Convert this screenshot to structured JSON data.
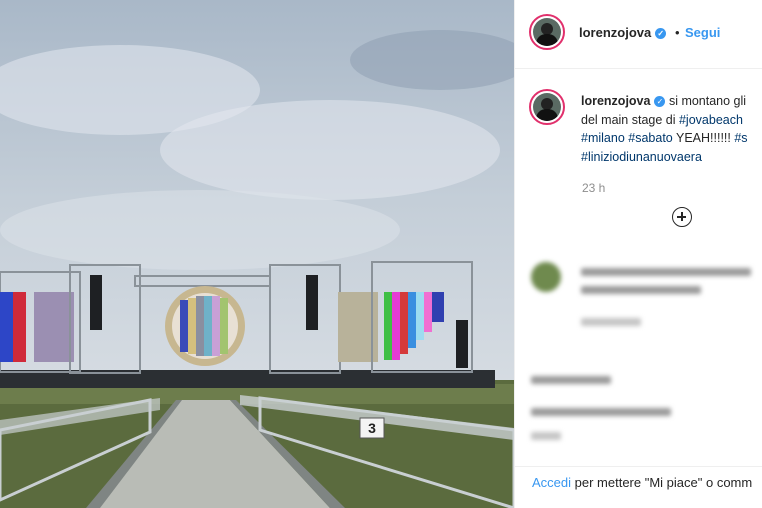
{
  "post": {
    "username": "lorenzojova",
    "verified_icon": "verified-badge-icon",
    "separator": "•",
    "follow_label": "Segui"
  },
  "caption": {
    "username": "lorenzojova",
    "line1_text": " si montano gli",
    "line2_text": "del main stage di ",
    "line2_tag": "#jovabeach",
    "line3_tag1": "#milano",
    "line3_tag2": "#sabato",
    "line3_text": " YEAH!!!!!! ",
    "line3_tag3": "#s",
    "line4_tag": "#liniziodiunanuovaera"
  },
  "time_label": "23 h",
  "load_more_icon": "plus-circle-icon",
  "footer": {
    "login_label": "Accedi",
    "rest_label": " per mettere \"Mi piace\" o comm"
  },
  "photo": {
    "sign_number": "3"
  },
  "colors": {
    "accent": "#3897f0",
    "text": "#262626",
    "muted": "#8e8e8e"
  }
}
